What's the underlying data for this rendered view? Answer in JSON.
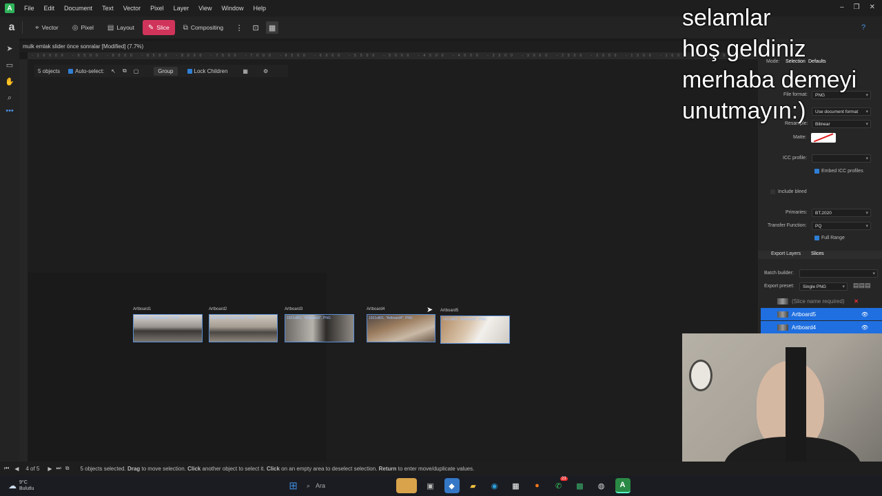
{
  "app": {
    "menu": [
      "File",
      "Edit",
      "Document",
      "Text",
      "Vector",
      "Pixel",
      "Layer",
      "View",
      "Window",
      "Help"
    ],
    "window_controls": [
      "–",
      "❐",
      "✕"
    ]
  },
  "toolbar": {
    "personas": [
      {
        "label": "Vector",
        "icon": "⌖",
        "active": false
      },
      {
        "label": "Pixel",
        "icon": "◎",
        "active": false
      },
      {
        "label": "Layout",
        "icon": "▤",
        "active": false
      },
      {
        "label": "Slice",
        "icon": "✎",
        "active": true
      },
      {
        "label": "Compositing",
        "icon": "⧉",
        "active": false
      }
    ]
  },
  "document": {
    "tab_title": "mulk emlak slider önce sonralar [Modified] (7.7%)",
    "ruler_ticks": "-10000 -9500 -9000 -8500 -8000 -7500 -7000 -6500 -6000 -5500 -5000 -4500 -4000 -3500 -3000 -2500 -2000 -1500 -1000 -500 0 500 1000 1500 2000 2500 3000 3500 4000 4500 5000 5500 6000 6500 7000 7500 8000 8500 9000"
  },
  "context_bar": {
    "objects": "5 objects",
    "auto_select": "Auto-select:",
    "group": "Group",
    "lock_children": "Lock Children"
  },
  "artboards": [
    {
      "name": "Artboard1",
      "caption": "1920x800, \"Artboard1\", PNG"
    },
    {
      "name": "Artboard2",
      "caption": "1921x800, \"Artboard2\", PNG"
    },
    {
      "name": "Artboard3",
      "caption": "1921x801, \"Artboard3\", PNG"
    },
    {
      "name": "Artboard4",
      "caption": "1921x801, \"Artboard4\", PNG"
    },
    {
      "name": "Artboard5",
      "caption": "1921x801, \"Artboard5\", PNG"
    }
  ],
  "export_panel": {
    "mode_label": "Mode:",
    "mode_tabs": [
      "Selection",
      "Defaults"
    ],
    "file_format_label": "File format:",
    "file_format": "PNG",
    "color_format": "Use document format",
    "resample_label": "Resample:",
    "resample": "Bilinear",
    "matte_label": "Matte:",
    "icc_label": "ICC profile:",
    "icc_value": "",
    "embed_icc": "Embed ICC profiles",
    "include_bleed": "Include bleed",
    "primaries_label": "Primaries:",
    "primaries": "BT.2020",
    "transfer_label": "Transfer Function:",
    "transfer": "PQ",
    "full_range": "Full Range"
  },
  "export_layers": {
    "tabs": [
      "Export Layers",
      "Slices"
    ],
    "batch_builder_label": "Batch builder:",
    "batch_builder": "",
    "export_preset_label": "Export preset:",
    "export_preset": "Single PNG",
    "rows": [
      {
        "label": "(Slice name required)",
        "selected": false
      },
      {
        "label": "Artboard5",
        "selected": true
      },
      {
        "label": "Artboard4",
        "selected": true
      }
    ]
  },
  "overlay_lines": [
    "selamlar",
    "hoş geldiniz",
    "merhaba demeyi",
    "unutmayın:)"
  ],
  "status": {
    "page": "4 of 5",
    "message_parts": [
      "5 objects selected. ",
      "Drag",
      " to move selection. ",
      "Click",
      " another object to select it. ",
      "Click",
      " on an empty area to deselect selection. ",
      "Return",
      " to enter move/duplicate values."
    ]
  },
  "taskbar": {
    "weather_temp": "9°C",
    "weather_desc": "Bulutlu",
    "search_placeholder": "Ara",
    "badge_count": "23"
  },
  "colors": {
    "accent": "#d0345a",
    "selection": "#1f6fe0",
    "check": "#2f7fd6"
  }
}
